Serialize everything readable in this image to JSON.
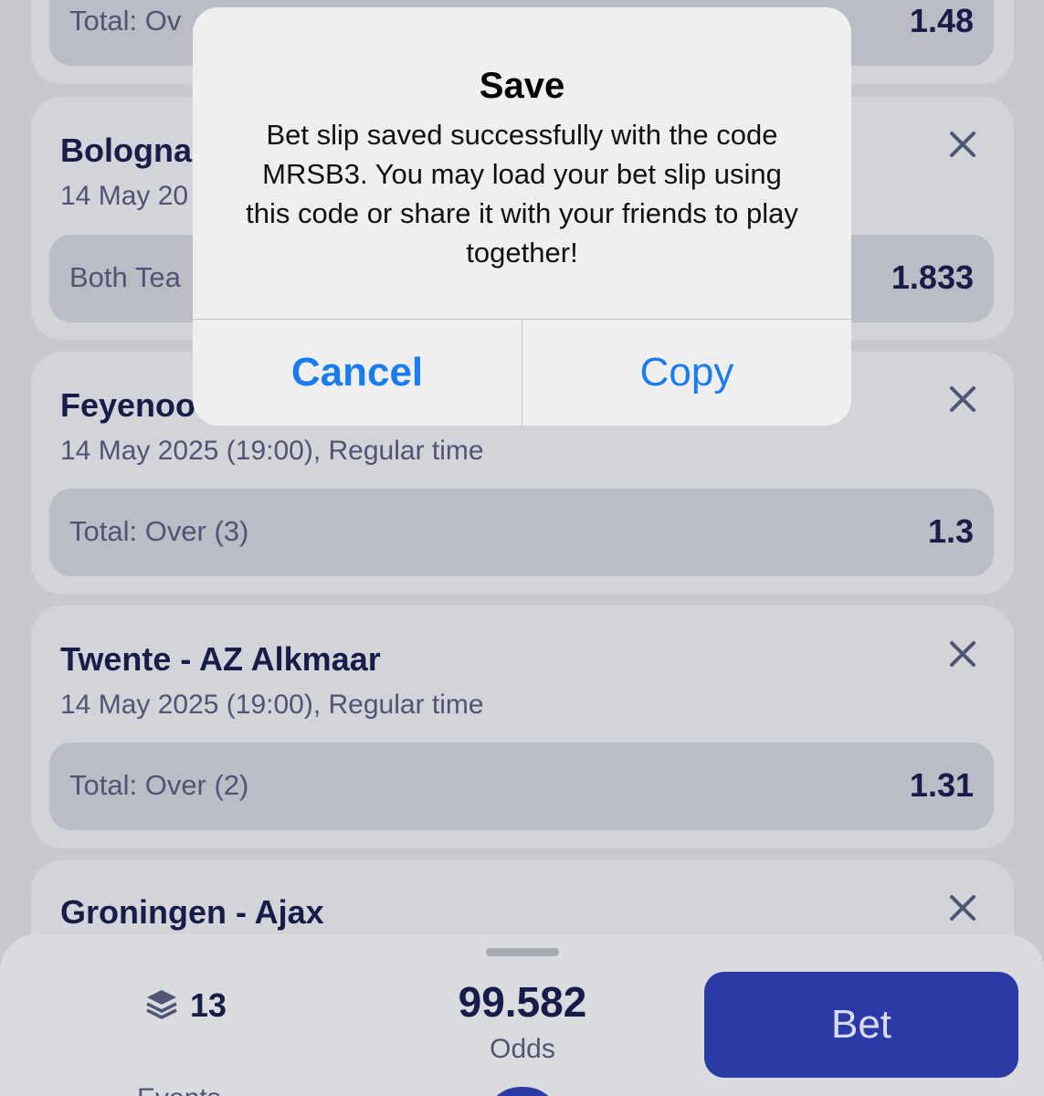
{
  "colors": {
    "accent": "#1a7cf0",
    "bet_button": "#2c3aa8",
    "title_text": "#171c48",
    "muted_text": "#4f5573"
  },
  "bets": [
    {
      "title": "",
      "subtitle": "",
      "market": "Total: Ov",
      "odd": "1.48"
    },
    {
      "title": "Bologna",
      "subtitle": "14 May 20",
      "market": "Both Tea",
      "odd": "1.833"
    },
    {
      "title": "Feyenoo",
      "subtitle": "14 May 2025 (19:00), Regular time",
      "market": "Total: Over (3)",
      "odd": "1.3"
    },
    {
      "title": "Twente - AZ Alkmaar",
      "subtitle": "14 May 2025 (19:00), Regular time",
      "market": "Total: Over (2)",
      "odd": "1.31"
    },
    {
      "title": "Groningen - Ajax"
    }
  ],
  "summary": {
    "events_icon": "layers-icon",
    "events_count": "13",
    "events_label": "Events",
    "odds_value": "99.582",
    "odds_label": "Odds",
    "bet_label": "Bet"
  },
  "alert": {
    "title": "Save",
    "message": "Bet slip saved successfully with the code MRSB3. You may load your bet slip using this code or share it with your friends to play together!",
    "cancel_label": "Cancel",
    "copy_label": "Copy"
  }
}
